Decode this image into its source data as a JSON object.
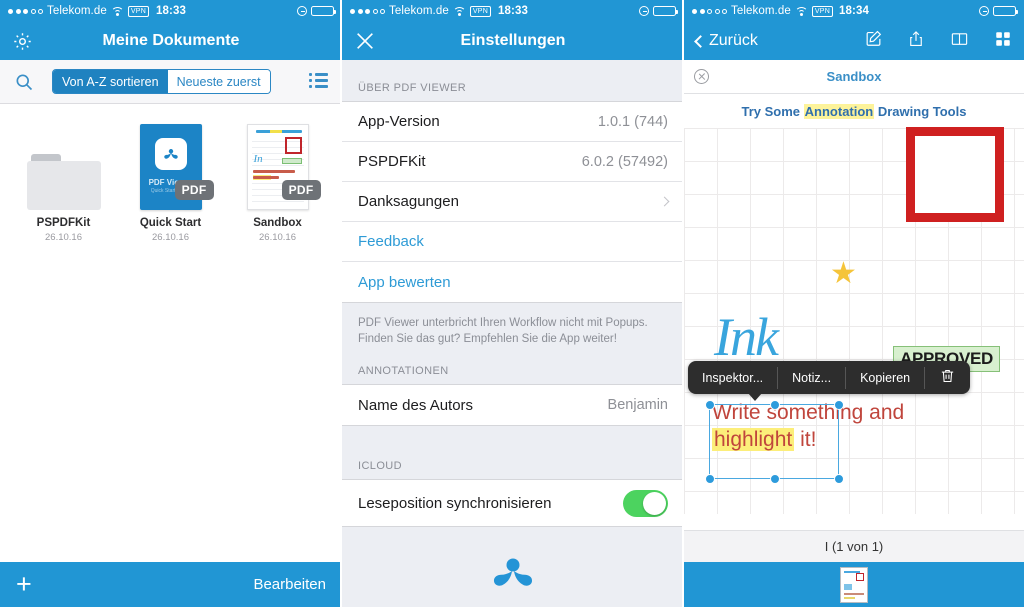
{
  "panel1": {
    "statusbar": {
      "carrier": "Telekom.de",
      "vpn": "VPN",
      "time": "18:33"
    },
    "navbar": {
      "title": "Meine Dokumente",
      "settings_icon": "gear-icon"
    },
    "toolbar": {
      "search_icon": "search-icon",
      "segment": {
        "options": [
          "Von A-Z sortieren",
          "Neueste zuerst"
        ],
        "selected": "Von A-Z sortieren"
      },
      "listview_icon": "list-view-icon"
    },
    "documents": [
      {
        "name": "PSPDFKit",
        "date": "26.10.16",
        "type": "folder",
        "badge": ""
      },
      {
        "name": "Quick Start",
        "date": "26.10.16",
        "type": "pdf",
        "badge": "PDF",
        "cover_title": "PDF Viewer",
        "cover_sub": "Quick Start Guide"
      },
      {
        "name": "Sandbox",
        "date": "26.10.16",
        "type": "pdf",
        "badge": "PDF"
      }
    ],
    "bottombar": {
      "add_label": "+",
      "edit_label": "Bearbeiten"
    }
  },
  "panel2": {
    "statusbar": {
      "carrier": "Telekom.de",
      "vpn": "VPN",
      "time": "18:33"
    },
    "navbar": {
      "title": "Einstellungen",
      "close_icon": "close-icon"
    },
    "sections": [
      {
        "header": "ÜBER PDF VIEWER",
        "rows": [
          {
            "label": "App-Version",
            "value": "1.0.1 (744)",
            "kind": "value"
          },
          {
            "label": "PSPDFKit",
            "value": "6.0.2 (57492)",
            "kind": "value"
          },
          {
            "label": "Danksagungen",
            "value": "",
            "kind": "chevron"
          },
          {
            "label": "Feedback",
            "value": "",
            "kind": "link"
          },
          {
            "label": "App bewerten",
            "value": "",
            "kind": "link"
          }
        ],
        "footer_note": "PDF Viewer unterbricht Ihren Workflow nicht mit Popups. Finden Sie das gut? Empfehlen Sie die App weiter!"
      },
      {
        "header": "ANNOTATIONEN",
        "rows": [
          {
            "label": "Name des Autors",
            "value": "Benjamin",
            "kind": "value"
          }
        ],
        "footer_note": ""
      },
      {
        "header": "ICLOUD",
        "rows": [
          {
            "label": "Leseposition synchronisieren",
            "value": "on",
            "kind": "toggle"
          }
        ],
        "footer_note": ""
      }
    ]
  },
  "panel3": {
    "statusbar": {
      "carrier": "Telekom.de",
      "vpn": "VPN",
      "time": "18:34"
    },
    "navbar": {
      "back_label": "Zurück",
      "icons": [
        "compose-icon",
        "share-icon",
        "book-icon",
        "grid-icon"
      ]
    },
    "document_tab": {
      "title": "Sandbox",
      "close_icon": "close-circle-icon"
    },
    "page_content": {
      "title_parts": [
        {
          "text": "Try Some ",
          "highlight": false
        },
        {
          "text": "Annotation",
          "highlight": true
        },
        {
          "text": " Drawing Tools",
          "highlight": false
        }
      ],
      "ink_word": "Ink",
      "stamp_text": "APPROVED",
      "star_icon": "star-icon",
      "red_square": "square-annotation",
      "selected_text_line1": "Write something and",
      "selected_text_highlight": "highlight",
      "selected_text_line2_rest": " it!"
    },
    "context_menu": {
      "items": [
        "Inspektor...",
        "Notiz...",
        "Kopieren"
      ],
      "delete_icon": "trash-icon"
    },
    "page_indicator": "I (1 von 1)",
    "bottombar": {
      "thumbnail_icon": "page-thumbnail-icon"
    }
  }
}
